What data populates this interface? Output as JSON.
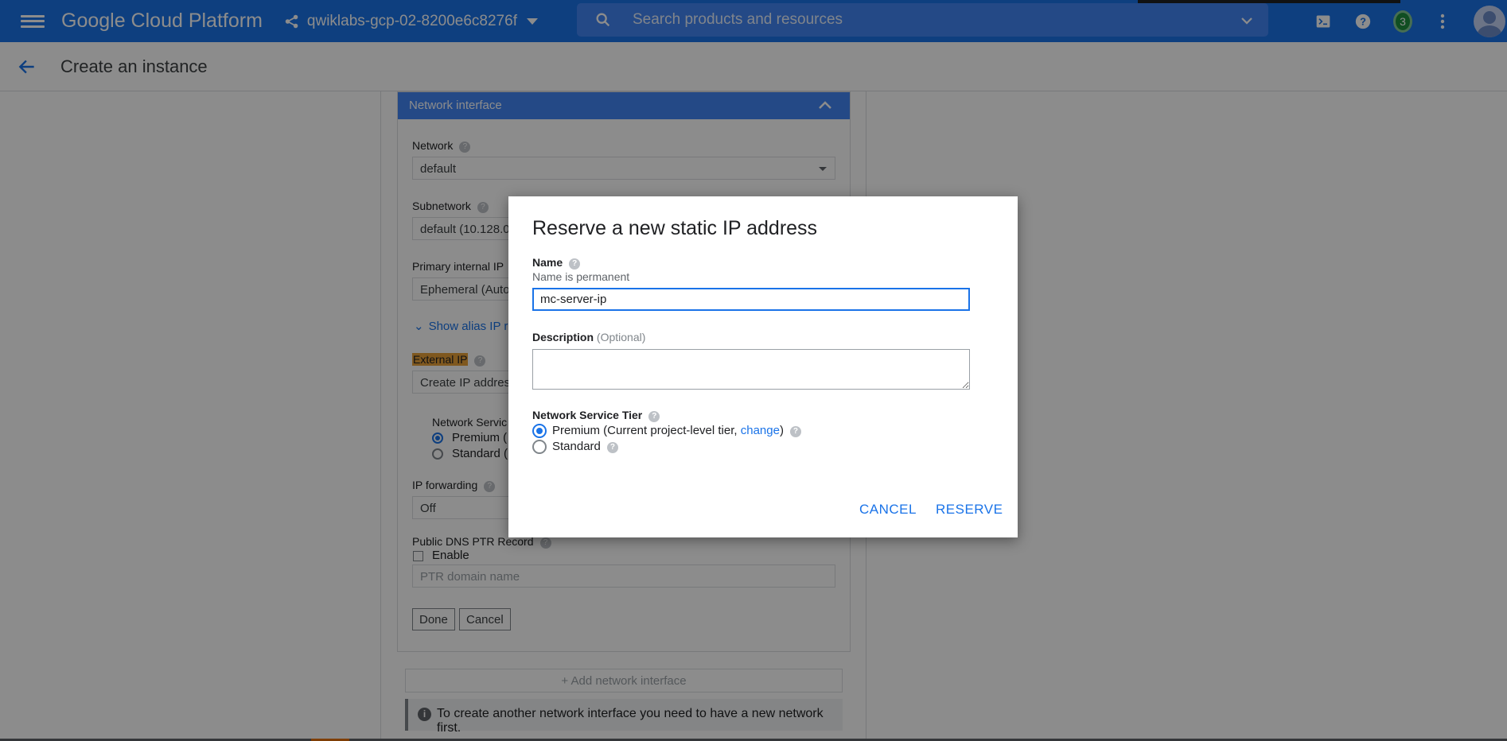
{
  "topbar": {
    "brand": "Google Cloud Platform",
    "project": "qwiklabs-gcp-02-8200e6c8276f",
    "search_placeholder": "Search products and resources",
    "notification_count": "3"
  },
  "page": {
    "title": "Create an instance"
  },
  "network_interface": {
    "header": "Network interface",
    "network_label": "Network",
    "network_value": "default",
    "subnetwork_label": "Subnetwork",
    "subnetwork_value": "default (10.128.0",
    "primary_ip_label": "Primary internal IP",
    "primary_ip_value": "Ephemeral (Auto",
    "alias_link": "Show alias IP ra",
    "external_ip_label": "External IP",
    "external_ip_value": "Create IP address",
    "tier_label": "Network Servic",
    "tier_premium": "Premium (",
    "tier_standard": "Standard (",
    "ip_forwarding_label": "IP forwarding",
    "ip_forwarding_value": "Off",
    "ptr_label": "Public DNS PTR Record",
    "ptr_enable": "Enable",
    "ptr_placeholder": "PTR domain name",
    "done": "Done",
    "cancel": "Cancel"
  },
  "add_network_interface": "+ Add network interface",
  "info_message": "To create another network interface you need to have a new network first.",
  "dialog": {
    "title": "Reserve a new static IP address",
    "name_label": "Name",
    "name_hint": "Name is permanent",
    "name_value": "mc-server-ip",
    "description_label": "Description",
    "description_optional": "(Optional)",
    "tier_label": "Network Service Tier",
    "premium_text": "Premium (Current project-level tier, ",
    "premium_link": "change",
    "premium_close": ")",
    "standard_text": "Standard",
    "selected_tier": "Premium",
    "cancel": "CANCEL",
    "reserve": "RESERVE"
  }
}
